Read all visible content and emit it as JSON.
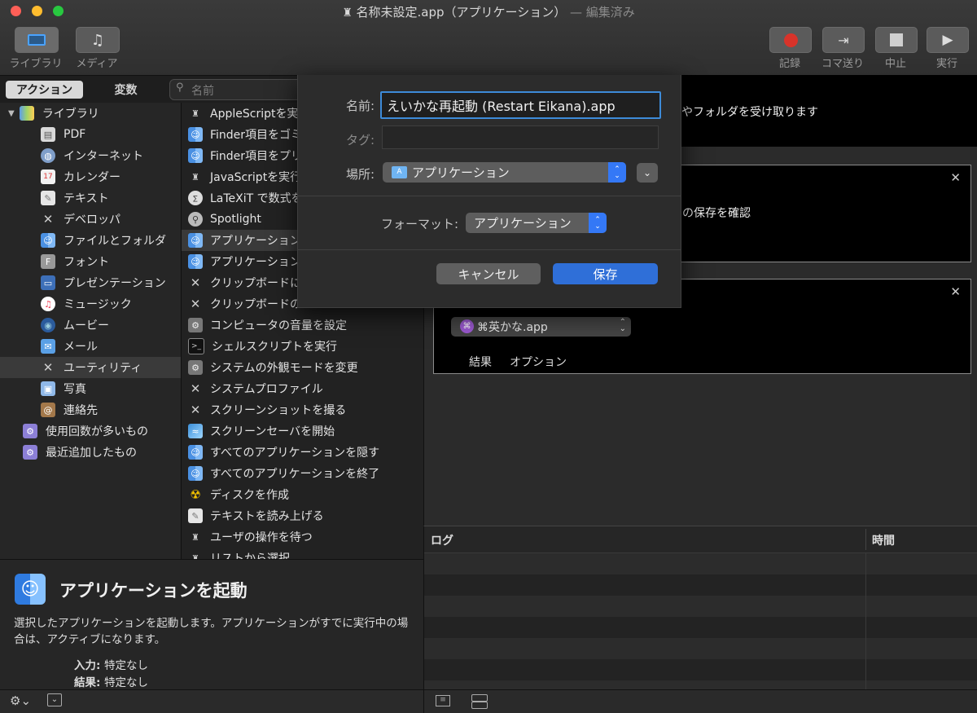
{
  "window": {
    "title": "名称未設定.app（アプリケーション）",
    "title_suffix": "— 編集済み",
    "traffic_lights": [
      "#fe5f57",
      "#febc2e",
      "#28c840"
    ]
  },
  "toolbar": {
    "library_label": "ライブラリ",
    "media_label": "メディア",
    "record_label": "記録",
    "step_label": "コマ送り",
    "stop_label": "中止",
    "run_label": "実行"
  },
  "sidebar": {
    "tab_actions": "アクション",
    "tab_variables": "変数",
    "search_placeholder": "名前",
    "library_root": "ライブラリ",
    "categories": [
      {
        "label": "PDF",
        "icon": "pdf-icon"
      },
      {
        "label": "インターネット",
        "icon": "globe-icon"
      },
      {
        "label": "カレンダー",
        "icon": "calendar-icon"
      },
      {
        "label": "テキスト",
        "icon": "text-icon"
      },
      {
        "label": "デベロッパ",
        "icon": "tools-icon"
      },
      {
        "label": "ファイルとフォルダ",
        "icon": "finder-icon"
      },
      {
        "label": "フォント",
        "icon": "font-icon"
      },
      {
        "label": "プレゼンテーション",
        "icon": "presentation-icon"
      },
      {
        "label": "ミュージック",
        "icon": "music-icon"
      },
      {
        "label": "ムービー",
        "icon": "movie-icon"
      },
      {
        "label": "メール",
        "icon": "mail-icon"
      },
      {
        "label": "ユーティリティ",
        "icon": "utilities-icon"
      },
      {
        "label": "写真",
        "icon": "photos-icon"
      },
      {
        "label": "連絡先",
        "icon": "contacts-icon"
      }
    ],
    "smart_folders": [
      "使用回数が多いもの",
      "最近追加したもの"
    ]
  },
  "actions": [
    {
      "label": "AppleScriptを実",
      "icon": "script-icon"
    },
    {
      "label": "Finder項目をゴミ",
      "icon": "finder-icon"
    },
    {
      "label": "Finder項目をプリ",
      "icon": "finder-icon"
    },
    {
      "label": "JavaScriptを実行",
      "icon": "script-icon"
    },
    {
      "label": "LaTeXiT で数式を",
      "icon": "latex-icon"
    },
    {
      "label": "Spotlight",
      "icon": "spotlight-icon"
    },
    {
      "label": "アプリケーション",
      "icon": "finder-icon"
    },
    {
      "label": "アプリケーション",
      "icon": "finder-icon"
    },
    {
      "label": "クリップボードに",
      "icon": "tools-icon"
    },
    {
      "label": "クリップボードの",
      "icon": "tools-icon"
    },
    {
      "label": "コンピュータの音量を設定",
      "icon": "prefs-icon"
    },
    {
      "label": "シェルスクリプトを実行",
      "icon": "terminal-icon"
    },
    {
      "label": "システムの外観モードを変更",
      "icon": "prefs-icon"
    },
    {
      "label": "システムプロファイル",
      "icon": "tools-icon"
    },
    {
      "label": "スクリーンショットを撮る",
      "icon": "tools-icon"
    },
    {
      "label": "スクリーンセーバを開始",
      "icon": "screensaver-icon"
    },
    {
      "label": "すべてのアプリケーションを隠す",
      "icon": "finder-icon"
    },
    {
      "label": "すべてのアプリケーションを終了",
      "icon": "finder-icon"
    },
    {
      "label": "ディスクを作成",
      "icon": "disk-icon"
    },
    {
      "label": "テキストを読み上げる",
      "icon": "text-icon"
    },
    {
      "label": "ユーザの操作を待つ",
      "icon": "script-icon"
    },
    {
      "label": "リストから選択",
      "icon": "script-icon"
    }
  ],
  "description": {
    "title": "アプリケーションを起動",
    "body": "選択したアプリケーションを起動します。アプリケーションがすでに実行中の場合は、アクティブになります。",
    "input_label": "入力:",
    "input_value": "特定なし",
    "result_label": "結果:",
    "result_value": "特定なし"
  },
  "workflow": {
    "header_text": "ルやフォルダを受け取ります",
    "block1_text": "の保存を確認",
    "block2_app": "⌘英かな.app",
    "block2_tab_results": "結果",
    "block2_tab_options": "オプション"
  },
  "log": {
    "col_log": "ログ",
    "col_time": "時間"
  },
  "save_sheet": {
    "name_label": "名前:",
    "name_value": "えいかな再起動 (Restart Eikana).app",
    "tags_label": "タグ:",
    "location_label": "場所:",
    "location_value": "アプリケーション",
    "format_label": "フォーマット:",
    "format_value": "アプリケーション",
    "cancel_label": "キャンセル",
    "save_label": "保存"
  }
}
